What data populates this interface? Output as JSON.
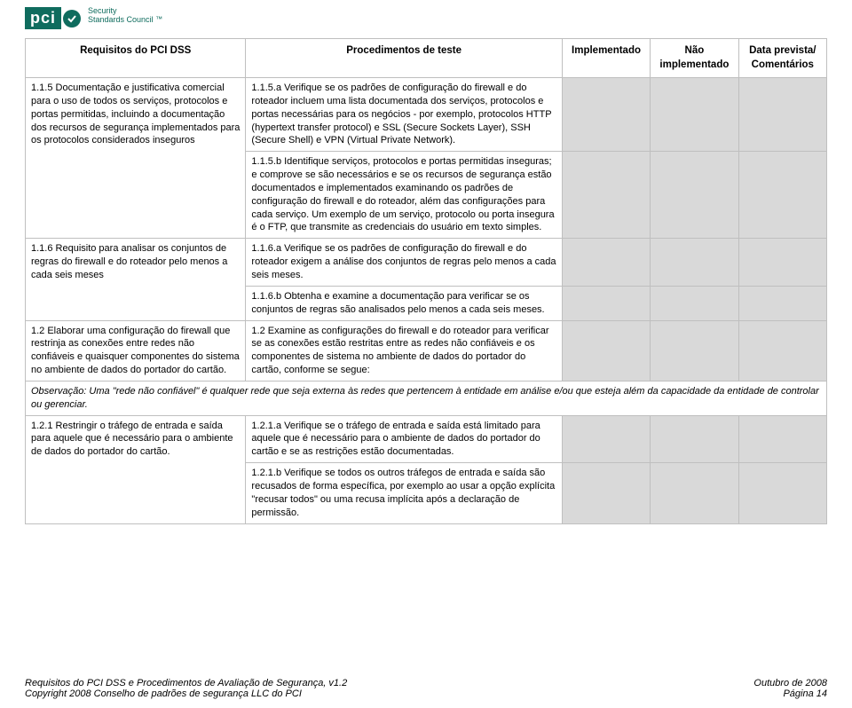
{
  "logo": {
    "pci": "pci",
    "line1": "Security",
    "line2": "Standards Council",
    "tm": "™"
  },
  "headers": {
    "req": "Requisitos do PCI DSS",
    "proc": "Procedimentos de teste",
    "impl": "Implementado",
    "notimpl": "Não implementado",
    "date": "Data prevista/ Comentários"
  },
  "rows": [
    {
      "req": "1.1.5    Documentação e justificativa comercial para o uso de todos os serviços, protocolos e portas permitidas, incluindo a documentação dos recursos de segurança implementados para os protocolos considerados inseguros",
      "proc_a": "1.1.5.a Verifique se os padrões de configuração do firewall e do roteador incluem uma lista documentada dos serviços, protocolos e portas necessárias para os negócios - por exemplo, protocolos HTTP (hypertext transfer protocol) e SSL (Secure Sockets Layer), SSH (Secure Shell) e VPN (Virtual Private Network).",
      "proc_b": "1.1.5.b Identifique serviços, protocolos e portas permitidas inseguras; e comprove se são necessários e se os recursos de segurança estão documentados e implementados examinando os padrões de configuração do firewall e do roteador, além das configurações para cada serviço. Um exemplo de um serviço, protocolo ou porta insegura é o FTP, que transmite as credenciais do usuário em texto simples."
    },
    {
      "req": "1.1.6    Requisito para analisar os conjuntos de regras do firewall e do roteador pelo menos a cada seis meses",
      "proc_a": "1.1.6.a Verifique se os padrões de configuração do firewall e do roteador exigem a análise dos conjuntos de regras pelo menos a cada seis meses.",
      "proc_b": "1.1.6.b Obtenha e examine a documentação para verificar se os conjuntos de regras são analisados pelo menos a cada seis meses."
    },
    {
      "req": "1.2      Elaborar uma configuração do firewall que restrinja as conexões entre redes não confiáveis e quaisquer componentes do sistema no ambiente de dados do portador do cartão.",
      "proc": "1.2      Examine as configurações do firewall e do roteador para verificar se as conexões estão restritas entre as redes não confiáveis e os componentes de sistema no ambiente de dados do portador do cartão, conforme se segue:"
    },
    {
      "req": "1.2.1    Restringir o tráfego de entrada e saída para aquele que é necessário para o ambiente de dados do portador do cartão.",
      "proc_a": "1.2.1.a Verifique se o tráfego de entrada e saída está limitado para aquele que é necessário para o ambiente de dados do portador do cartão e se as restrições estão documentadas.",
      "proc_b": "1.2.1.b Verifique se todos os outros tráfegos de entrada e saída são recusados de forma específica, por exemplo ao usar a opção explícita \"recusar todos\" ou uma recusa implícita após a declaração de permissão."
    }
  ],
  "note": {
    "label": "Observação: ",
    "body": "Uma \"rede não confiável\" é qualquer rede que seja externa às redes que pertencem à entidade em análise e/ou que esteja além da capacidade da entidade de controlar ou gerenciar."
  },
  "footer": {
    "left1": "Requisitos do PCI DSS e Procedimentos de Avaliação de Segurança, v1.2",
    "left2": "Copyright 2008 Conselho de padrões de segurança LLC do PCI",
    "right1": "Outubro de 2008",
    "right2": "Página 14"
  }
}
